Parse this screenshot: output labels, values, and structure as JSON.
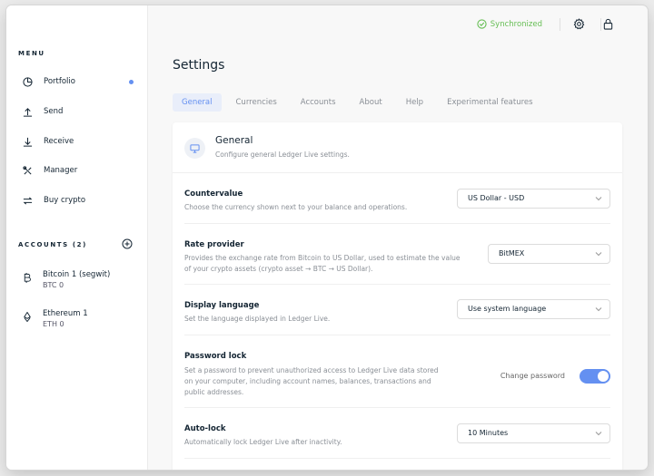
{
  "window": {
    "traffic_lights": [
      "#fc605b",
      "#fdbc40",
      "#34c84a"
    ]
  },
  "sidebar": {
    "menu_title": "MENU",
    "items": [
      {
        "label": "Portfolio",
        "icon": "pie-chart-icon",
        "has_dot": true
      },
      {
        "label": "Send",
        "icon": "arrow-up-icon"
      },
      {
        "label": "Receive",
        "icon": "arrow-down-icon"
      },
      {
        "label": "Manager",
        "icon": "tools-icon"
      },
      {
        "label": "Buy crypto",
        "icon": "exchange-icon"
      }
    ],
    "accounts_title": "ACCOUNTS (2)",
    "accounts": [
      {
        "name": "Bitcoin 1 (segwit)",
        "balance": "BTC 0",
        "icon": "bitcoin-icon"
      },
      {
        "name": "Ethereum 1",
        "balance": "ETH 0",
        "icon": "ethereum-icon"
      }
    ]
  },
  "topbar": {
    "status": "Synchronized",
    "status_color": "#66be54"
  },
  "page": {
    "title": "Settings",
    "tabs": [
      "General",
      "Currencies",
      "Accounts",
      "About",
      "Help",
      "Experimental features"
    ],
    "active_tab": "General"
  },
  "card": {
    "title": "General",
    "description": "Configure general Ledger Live settings."
  },
  "settings": [
    {
      "label": "Countervalue",
      "description": "Choose the currency shown next to your balance and operations.",
      "value": "US Dollar - USD"
    },
    {
      "label": "Rate provider",
      "description": "Provides the exchange rate from Bitcoin to US Dollar, used to estimate the value of your crypto assets (crypto asset → BTC → US Dollar).",
      "value": "BitMEX"
    },
    {
      "label": "Display language",
      "description": "Set the language displayed in Ledger Live.",
      "value": "Use system language"
    },
    {
      "label": "Password lock",
      "description": "Set a password to prevent unauthorized access to Ledger Live data stored on your computer, including account names, balances, transactions and public addresses.",
      "action": "Change password",
      "enabled": true
    },
    {
      "label": "Auto-lock",
      "description": "Automatically lock Ledger Live after inactivity.",
      "value": "10 Minutes"
    }
  ],
  "colors": {
    "accent": "#6490f1",
    "text": "#142533",
    "muted": "#8a8f96"
  }
}
